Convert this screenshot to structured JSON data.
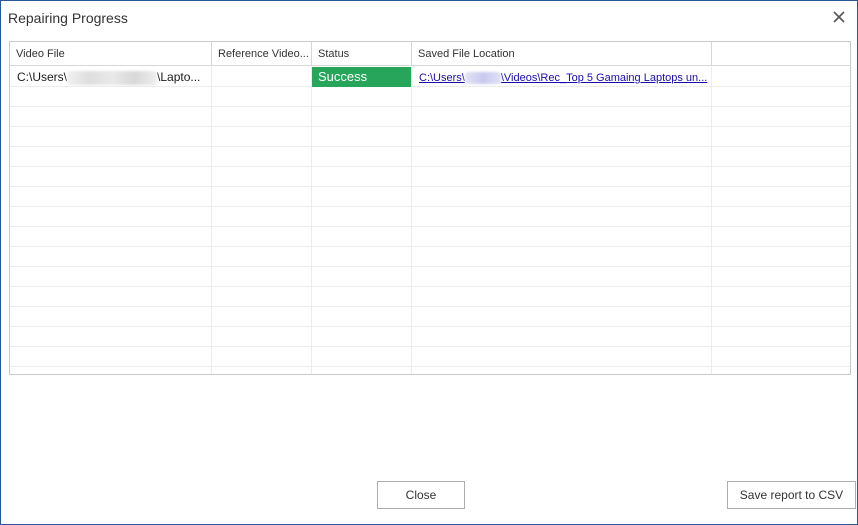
{
  "dialog": {
    "title": "Repairing Progress"
  },
  "table": {
    "columns": [
      "Video File",
      "Reference Video...",
      "Status",
      "Saved File Location",
      ""
    ],
    "rows": [
      {
        "video_file_prefix": "C:\\Users\\",
        "video_file_suffix": "\\Lapto...",
        "reference_video": "",
        "status": "Success",
        "saved_location_prefix": "C:\\Users\\",
        "saved_location_suffix": "\\Videos\\Rec_Top 5 Gamaing Laptops un..."
      }
    ],
    "status_color": "#27a55a",
    "link_color": "#1a0dab"
  },
  "footer": {
    "close_label": "Close",
    "save_csv_label": "Save report to CSV"
  }
}
